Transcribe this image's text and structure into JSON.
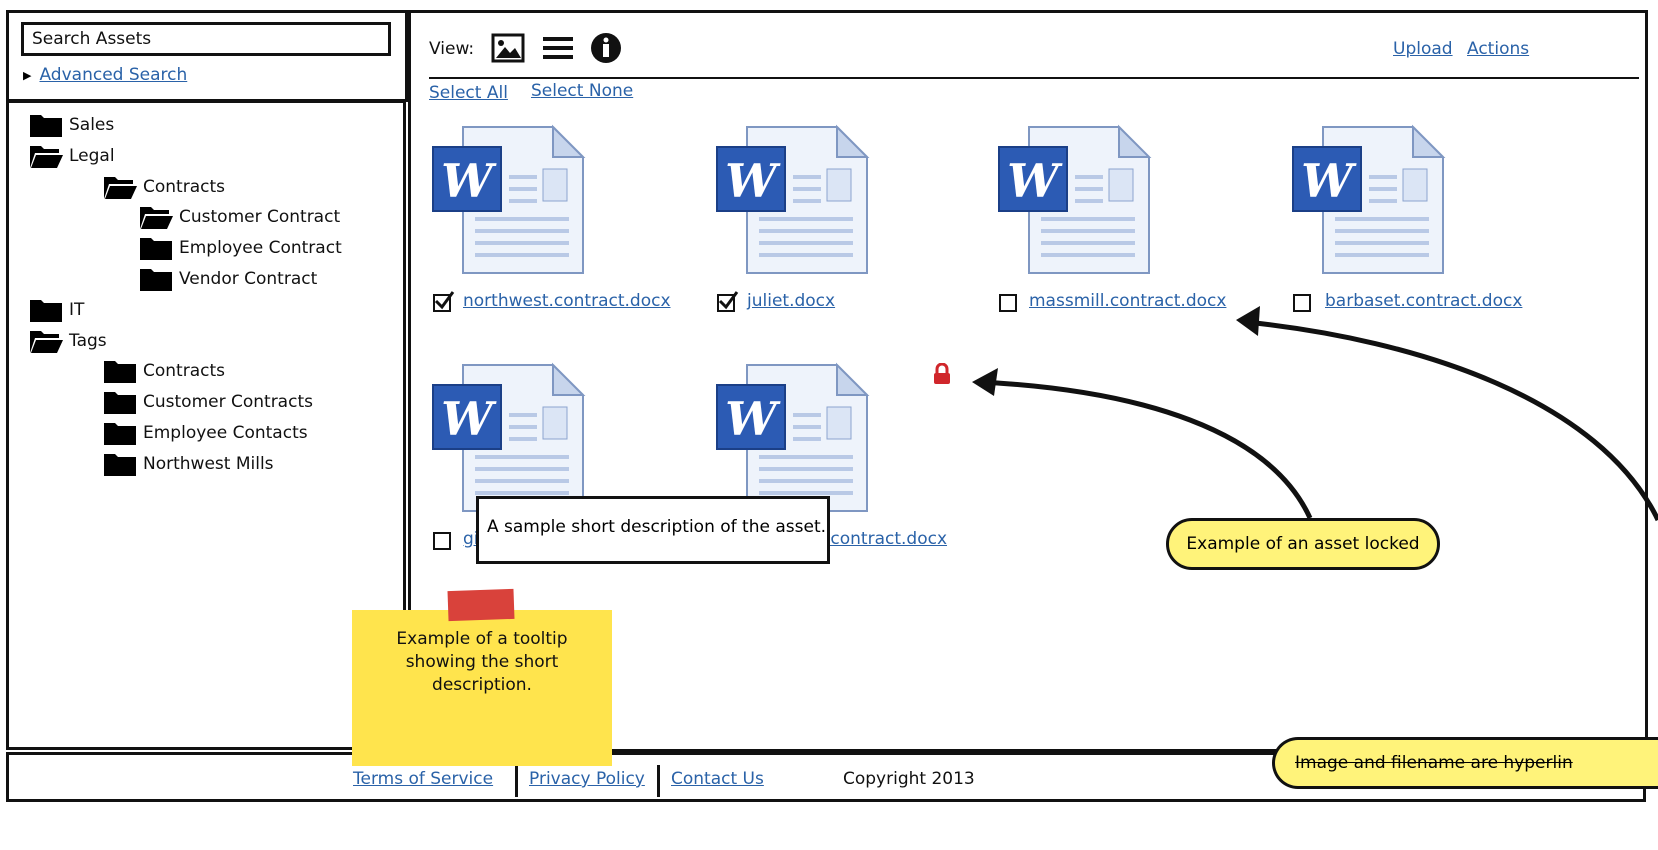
{
  "search": {
    "placeholder": "Search Assets",
    "advanced_label": "Advanced Search"
  },
  "tree": [
    {
      "label": "Sales",
      "open": false,
      "level": 0
    },
    {
      "label": "Legal",
      "open": true,
      "level": 0
    },
    {
      "label": "Contracts",
      "open": true,
      "level": 2
    },
    {
      "label": "Customer Contract",
      "open": true,
      "level": 3
    },
    {
      "label": "Employee Contract",
      "open": false,
      "level": 3
    },
    {
      "label": "Vendor Contract",
      "open": false,
      "level": 3
    },
    {
      "label": "IT",
      "open": false,
      "level": 0
    },
    {
      "label": "Tags",
      "open": true,
      "level": 0
    },
    {
      "label": "Contracts",
      "open": false,
      "level": 2
    },
    {
      "label": "Customer Contracts",
      "open": false,
      "level": 2
    },
    {
      "label": "Employee Contacts",
      "open": false,
      "level": 2
    },
    {
      "label": "Northwest Mills",
      "open": false,
      "level": 2
    }
  ],
  "toolbar": {
    "view_label": "View:",
    "upload_label": "Upload",
    "actions_label": "Actions",
    "select_all": "Select All",
    "select_none": "Select None"
  },
  "files": [
    {
      "name": "northwest.contract.docx",
      "checked": true
    },
    {
      "name": "juliet.docx",
      "checked": true
    },
    {
      "name": "massmill.contract.docx",
      "checked": false
    },
    {
      "name": "barbaset.contract.docx",
      "checked": false
    },
    {
      "name": "gi",
      "checked": false
    },
    {
      "name": ".contract.docx",
      "checked": false
    }
  ],
  "tooltip": {
    "text": "A sample short description of the asset."
  },
  "annotations": {
    "locked": "Example of an asset locked",
    "sticky": "Example of a tooltip showing the short description.",
    "hyperlink": "Image and filename are hyperlin"
  },
  "footer": {
    "terms": "Terms of Service",
    "privacy": "Privacy Policy",
    "contact": "Contact Us",
    "copyright": "Copyright 2013"
  },
  "colors": {
    "link": "#2a62a8",
    "callout": "#fff37a",
    "sticky": "#ffe44d",
    "lock": "#d0262b",
    "tape": "#d9423b"
  }
}
